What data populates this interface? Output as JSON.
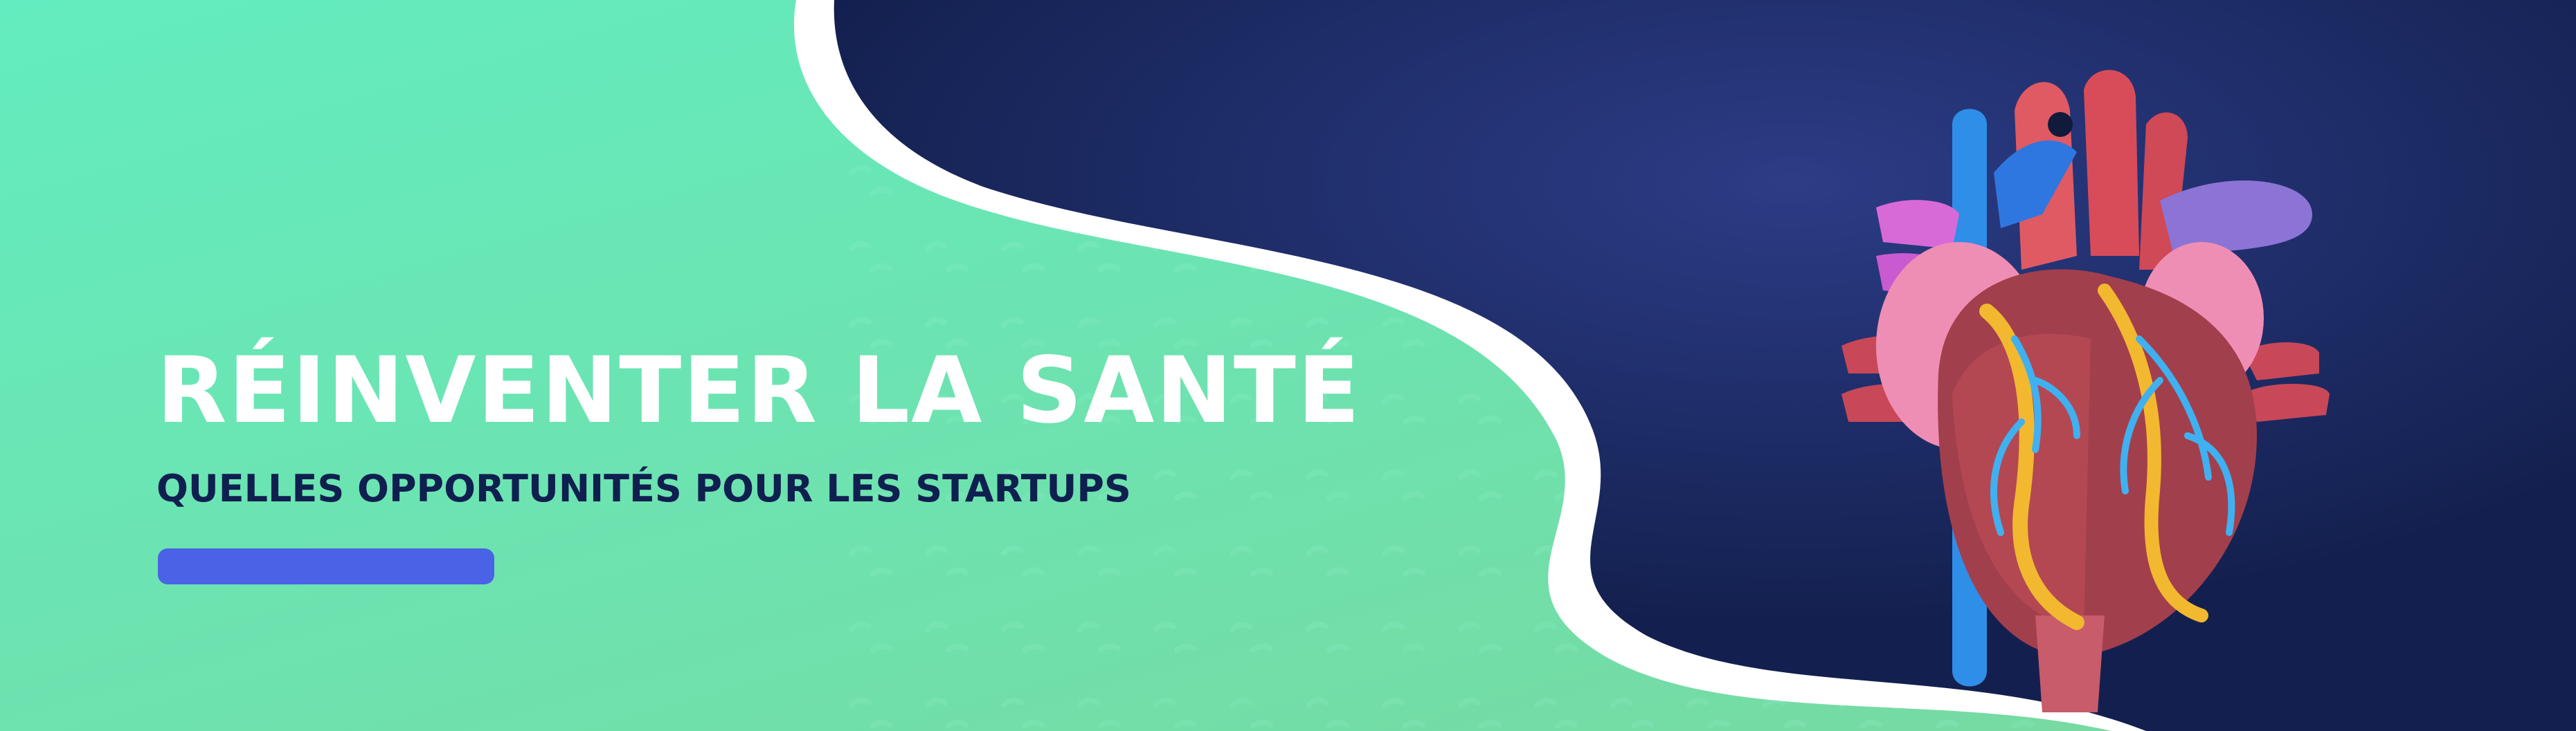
{
  "banner": {
    "title": "RÉINVENTER LA SANTÉ",
    "subtitle": "QUELLES OPPORTUNITÉS POUR LES STARTUPS"
  },
  "colors": {
    "mint_light": "#63ecbf",
    "mint_dark": "#74dba2",
    "navy": "#16265a",
    "navy_glow": "#2c3c86",
    "accent_bar": "#4a63e6",
    "title_text": "#ffffff",
    "subtitle_text": "#0f1f4f"
  },
  "illustration": {
    "icon": "human-heart-icon"
  }
}
